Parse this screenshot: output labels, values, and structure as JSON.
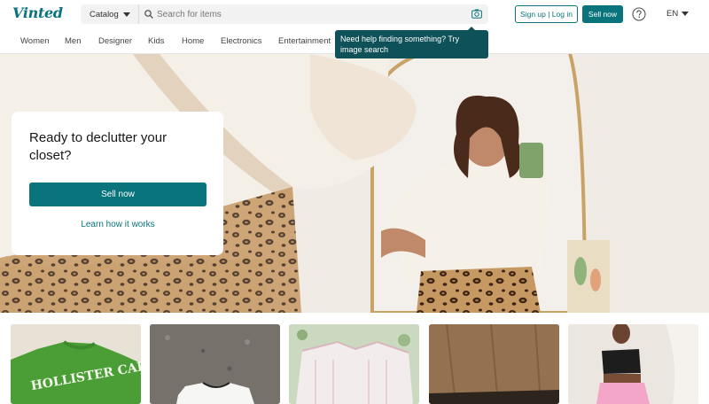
{
  "header": {
    "logo": "Vinted",
    "catalog_label": "Catalog",
    "search_placeholder": "Search for items",
    "signup_label": "Sign up | Log in",
    "sell_label": "Sell now",
    "language": "EN"
  },
  "nav": {
    "items": [
      "Women",
      "Men",
      "Designer",
      "Kids",
      "Home",
      "Electronics",
      "Entertainment"
    ]
  },
  "tooltip": {
    "text": "Need help finding something? Try image search"
  },
  "hero": {
    "title": "Ready to declutter your closet?",
    "sell_button": "Sell now",
    "learn_link": "Learn how it works"
  },
  "products": {
    "items": [
      {
        "caption": "HOLLISTER CALIFORNIA"
      },
      {
        "caption": ""
      },
      {
        "caption": ""
      },
      {
        "caption": ""
      },
      {
        "caption": ""
      }
    ]
  },
  "colors": {
    "brand": "#09747c",
    "tooltip_bg": "#0f5158"
  },
  "icons": [
    "search-icon",
    "camera-icon",
    "help-icon",
    "chevron-down-icon"
  ]
}
